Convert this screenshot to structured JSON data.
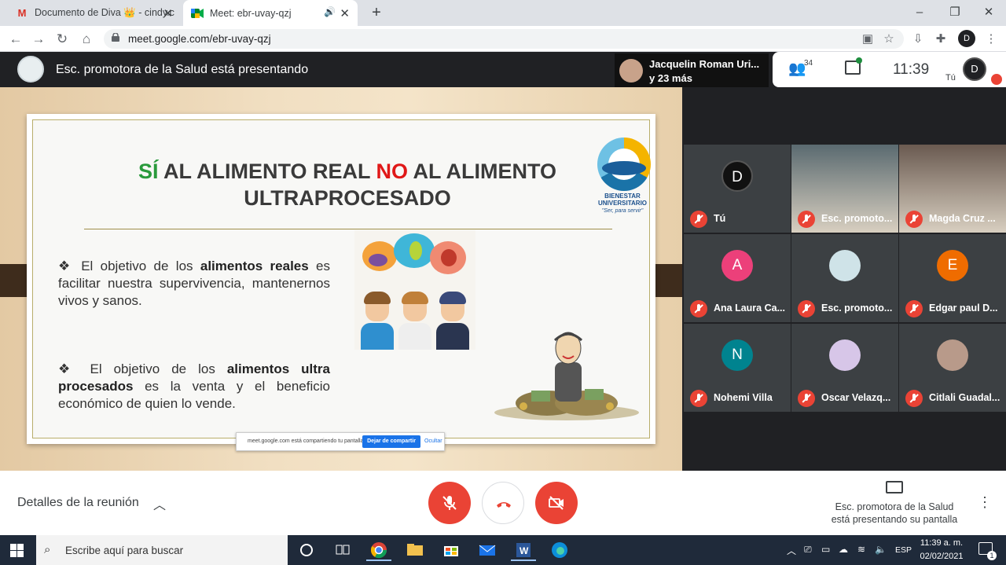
{
  "browser": {
    "tabs": [
      {
        "title": "Documento de Diva 👑 - cindy.c",
        "favicon": "gmail-icon",
        "active": false
      },
      {
        "title": "Meet: ebr-uvay-qzj",
        "favicon": "meet-icon",
        "active": true
      }
    ],
    "url": "meet.google.com/ebr-uvay-qzj"
  },
  "meet": {
    "presenting_banner": "Esc. promotora de la Salud está presentando",
    "others_name": "Jacquelin Roman Uri...",
    "others_more": "y 23 más",
    "participant_count": "34",
    "time": "11:39",
    "self_label": "Tú",
    "self_initials": "D"
  },
  "slide": {
    "title_part1": "SÍ",
    "title_part2": " AL ALIMENTO REAL ",
    "title_part3": "NO",
    "title_part4": " AL ALIMENTO ULTRAPROCESADO",
    "bullet1_pre": "El objetivo de los ",
    "bullet1_bold": "alimentos reales",
    "bullet1_post": " es facilitar nuestra supervivencia, mantenernos vivos y sanos.",
    "bullet2_pre": "El objetivo de los ",
    "bullet2_bold": "alimentos ultra procesados",
    "bullet2_post": " es la venta y el beneficio económico de quien lo vende.",
    "logo_text": "BIENESTAR UNIVERSITARIO",
    "logo_slogan": "\"Ser, para servir\"",
    "share_notice": "meet.google.com está compartiendo tu pantalla.",
    "share_stop": "Dejar de compartir",
    "share_hide": "Ocultar"
  },
  "participants": [
    {
      "name": "Tú",
      "initial": "D",
      "color": "#111111",
      "type": "avatar"
    },
    {
      "name": "Esc. promoto...",
      "initial": "",
      "color": "#5a6a70",
      "type": "video"
    },
    {
      "name": "Magda Cruz ...",
      "initial": "",
      "color": "#6a5a50",
      "type": "video"
    },
    {
      "name": "Ana Laura Ca...",
      "initial": "A",
      "color": "#ec407a",
      "type": "avatar"
    },
    {
      "name": "Esc. promoto...",
      "initial": "",
      "color": "#cfe3e8",
      "type": "avatar"
    },
    {
      "name": "Edgar paul D...",
      "initial": "E",
      "color": "#ef6c00",
      "type": "avatar"
    },
    {
      "name": "Nohemi Villa",
      "initial": "N",
      "color": "#00838f",
      "type": "avatar"
    },
    {
      "name": "Oscar Velazq...",
      "initial": "",
      "color": "#d7c6e8",
      "type": "avatar"
    },
    {
      "name": "Citlali Guadal...",
      "initial": "",
      "color": "#b89a8a",
      "type": "avatar"
    }
  ],
  "bottom": {
    "details": "Detalles de la reunión",
    "presenting_line1": "Esc. promotora de la Salud",
    "presenting_line2": "está presentando su pantalla"
  },
  "taskbar": {
    "search_placeholder": "Escribe aquí para buscar",
    "lang": "ESP",
    "time": "11:39 a. m.",
    "date": "02/02/2021",
    "notifications": "1"
  },
  "colors": {
    "meet_red": "#ea4335",
    "slide_green": "#2a9a3c",
    "slide_red": "#e01818"
  }
}
